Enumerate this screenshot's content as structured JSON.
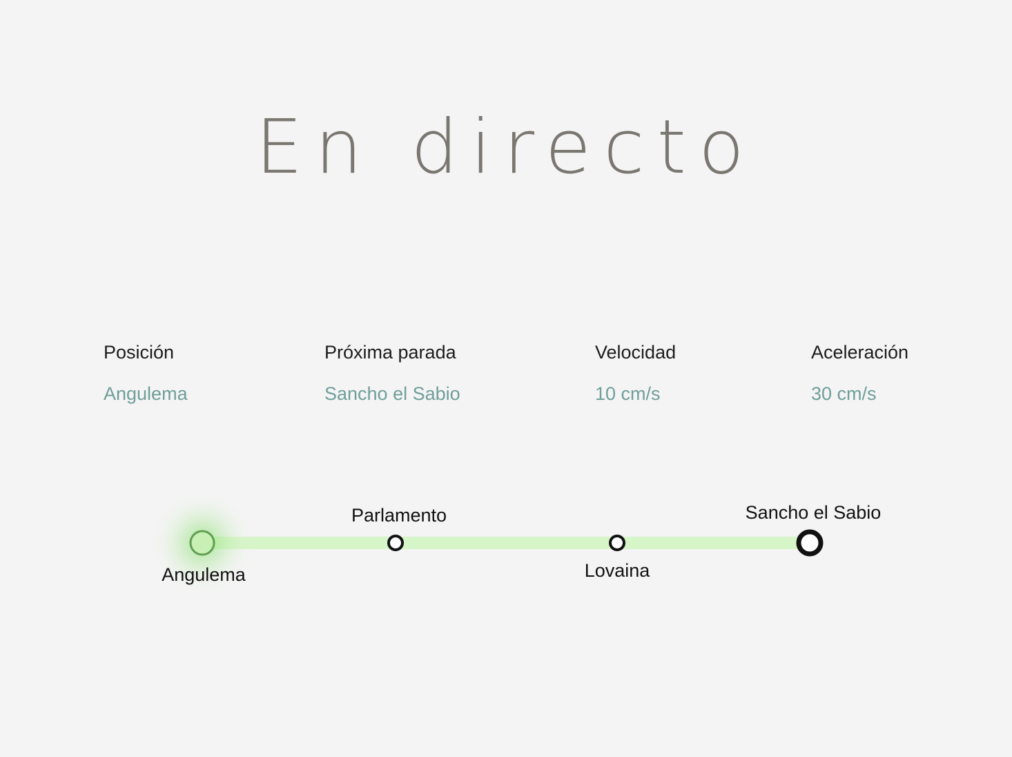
{
  "title": "En directo",
  "stats": [
    {
      "label": "Posición",
      "value": "Angulema"
    },
    {
      "label": "Próxima parada",
      "value": "Sancho el Sabio"
    },
    {
      "label": "Velocidad",
      "value": "10 cm/s"
    },
    {
      "label": "Aceleración",
      "value": "30 cm/s"
    }
  ],
  "route": {
    "stops": [
      {
        "name": "Angulema",
        "state": "current"
      },
      {
        "name": "Parlamento",
        "state": "upcoming"
      },
      {
        "name": "Lovaina",
        "state": "upcoming"
      },
      {
        "name": "Sancho el Sabio",
        "state": "next"
      }
    ],
    "colors": {
      "track": "#d6f5c8",
      "current_glow": "#8fdc76",
      "current_ring": "#5f9e52",
      "stop_ring": "#111111"
    }
  }
}
